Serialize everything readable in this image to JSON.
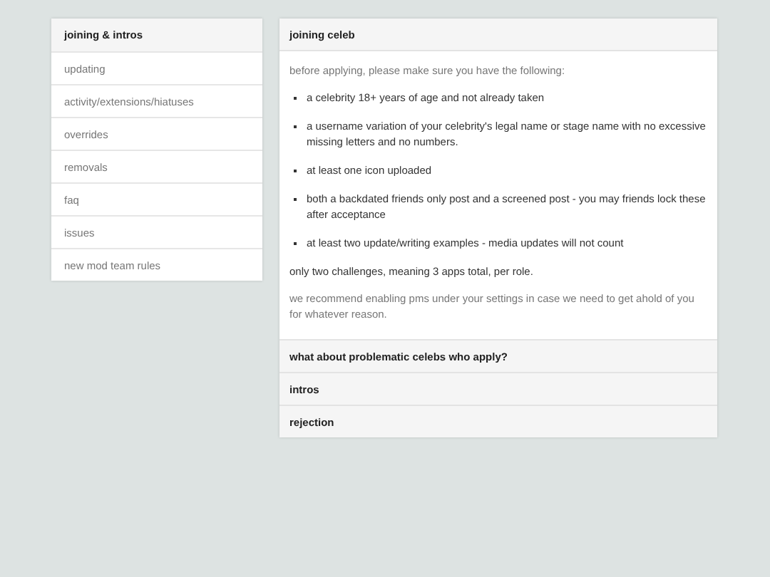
{
  "sidebar": {
    "items": [
      {
        "label": "joining & intros",
        "selected": true
      },
      {
        "label": "updating",
        "selected": false
      },
      {
        "label": "activity/extensions/hiatuses",
        "selected": false
      },
      {
        "label": "overrides",
        "selected": false
      },
      {
        "label": "removals",
        "selected": false
      },
      {
        "label": "faq",
        "selected": false
      },
      {
        "label": "issues",
        "selected": false
      },
      {
        "label": "new mod team rules",
        "selected": false
      }
    ]
  },
  "sections": [
    {
      "title": "joining celeb",
      "expanded": true,
      "content": [
        {
          "kind": "note",
          "text": "before applying, please make sure you have the following:"
        },
        {
          "kind": "bullet",
          "text": "a celebrity 18+ years of age and not already taken"
        },
        {
          "kind": "bullet",
          "text": "a username variation of your celebrity's legal name or stage name with no excessive missing letters and no numbers."
        },
        {
          "kind": "bullet",
          "text": "at least one icon uploaded"
        },
        {
          "kind": "bullet",
          "text": "both a backdated friends only post and a screened post - you may friends lock these after acceptance"
        },
        {
          "kind": "bullet",
          "text": "at least two update/writing examples - media updates will not count"
        },
        {
          "kind": "plain",
          "text": "only two challenges, meaning 3 apps total, per role."
        },
        {
          "kind": "note",
          "text": "we recommend enabling pms under your settings in case we need to get ahold of you for whatever reason."
        }
      ]
    },
    {
      "title": "what about problematic celebs who apply?",
      "expanded": false
    },
    {
      "title": "intros",
      "expanded": false
    },
    {
      "title": "rejection",
      "expanded": false
    }
  ]
}
